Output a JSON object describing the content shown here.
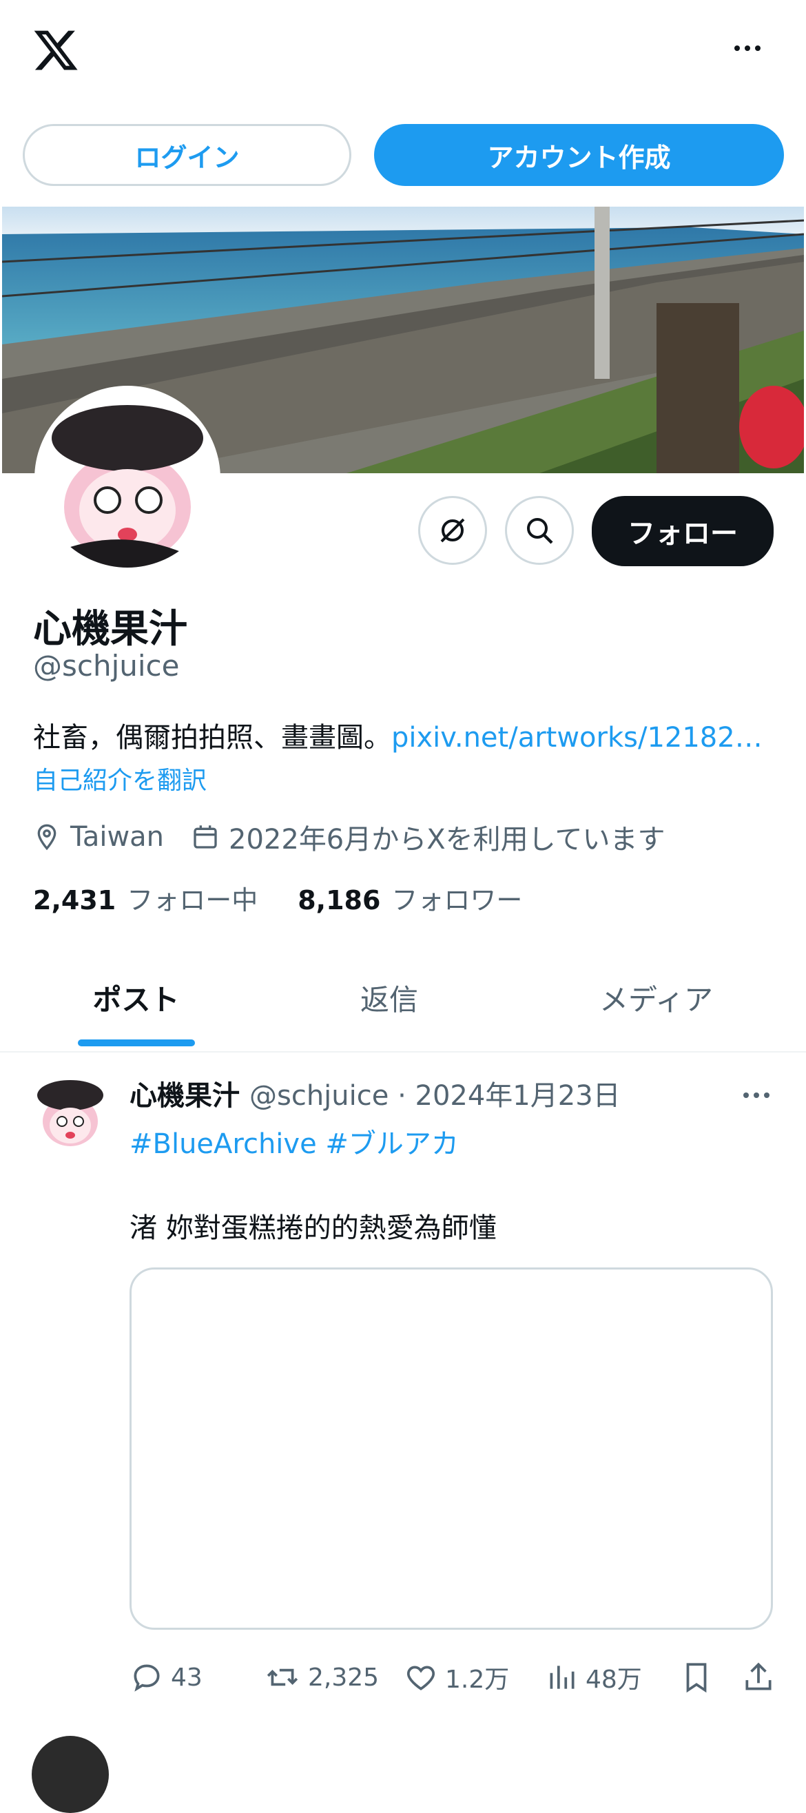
{
  "header": {
    "logo_icon": "x-logo-icon",
    "more_icon": "more-horizontal-icon"
  },
  "auth": {
    "login_label": "ログイン",
    "signup_label": "アカウント作成"
  },
  "profile": {
    "display_name": "心機果汁",
    "handle": "@schjuice",
    "bio_text": "社畜，偶爾拍拍照、畫畫圖。",
    "bio_link": "pixiv.net/artworks/12182…",
    "translate_label": "自己紹介を翻訳",
    "location": "Taiwan",
    "joined": "2022年6月からXを利用しています",
    "following_count": "2,431",
    "following_label": "フォロー中",
    "followers_count": "8,186",
    "followers_label": "フォロワー",
    "follow_button": "フォロー"
  },
  "tabs": [
    {
      "label": "ポスト",
      "active": true
    },
    {
      "label": "返信",
      "active": false
    },
    {
      "label": "メディア",
      "active": false
    }
  ],
  "post": {
    "author_name": "心機果汁",
    "author_meta": "@schjuice · 2024年1月23日",
    "hashtags": "#BlueArchive #ブルアカ",
    "text": "渚 妳對蛋糕捲的的熱愛為師懂",
    "reply_count": "43",
    "retweet_count": "2,325",
    "like_count": "1.2万",
    "view_count": "48万"
  },
  "colors": {
    "accent": "#1d9bf0",
    "text_primary": "#0f1419",
    "text_secondary": "#536471",
    "border": "#cfd9de"
  }
}
